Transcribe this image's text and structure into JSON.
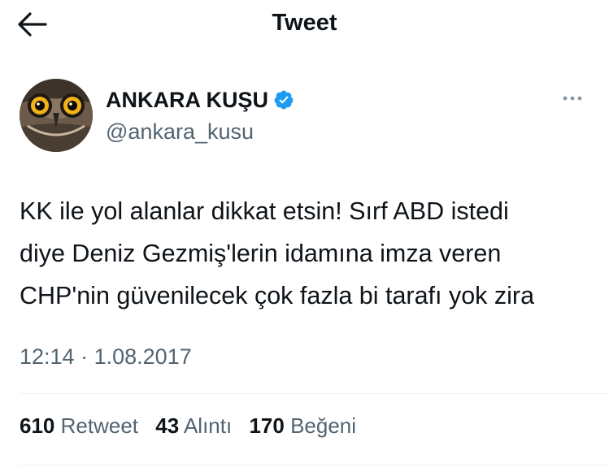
{
  "header": {
    "title": "Tweet",
    "back_icon": "arrow-left-icon"
  },
  "author": {
    "display_name": "ANKARA KUŞU",
    "handle": "@ankara_kusu",
    "verified_icon": "verified-badge-icon",
    "verified_color": "#1d9bf0",
    "avatar": "owl-avatar"
  },
  "more_icon": "more-horizontal-icon",
  "tweet": {
    "lines": [
      "KK ile yol alanlar dikkat etsin! Sırf ABD istedi",
      "diye Deniz Gezmiş'lerin idamına imza veren",
      "CHP'nin güvenilecek çok fazla bi tarafı yok zira"
    ],
    "time": "12:14",
    "separator": "·",
    "date": "1.08.2017"
  },
  "stats": {
    "retweets": {
      "count": "610",
      "label": "Retweet"
    },
    "quotes": {
      "count": "43",
      "label": "Alıntı"
    },
    "likes": {
      "count": "170",
      "label": "Beğeni"
    }
  },
  "colors": {
    "text": "#0f1419",
    "secondary": "#536471",
    "divider": "#eff3f4"
  }
}
